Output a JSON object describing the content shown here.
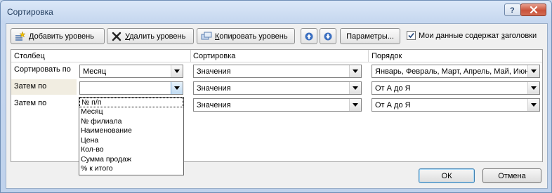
{
  "window": {
    "title": "Сортировка"
  },
  "toolbar": {
    "add_level": {
      "prefix": "",
      "underline": "Д",
      "rest": "обавить уровень"
    },
    "delete_level": {
      "prefix": "",
      "underline": "У",
      "rest": "далить уровень"
    },
    "copy_level": {
      "prefix": "",
      "underline": "К",
      "rest": "опировать уровень"
    },
    "parameters": "Параметры...",
    "headers_checkbox": {
      "label_a": "Мои данные содержат ",
      "underline": "з",
      "label_b": "аголовки",
      "checked": true
    }
  },
  "grid": {
    "headers": {
      "column": "Столбец",
      "sort": "Сортировка",
      "order": "Порядок"
    },
    "rows": [
      {
        "label": "Сортировать по",
        "column": "Месяц",
        "sort": "Значения",
        "order": "Январь, Февраль, Март, Апрель, Май, Июнь"
      },
      {
        "label": "Затем по",
        "column": "",
        "sort": "Значения",
        "order": "От А до Я"
      },
      {
        "label": "Затем по",
        "column": "",
        "sort": "Значения",
        "order": "От А до Я"
      }
    ]
  },
  "dropdown": {
    "options": [
      "№ п/п",
      "Месяц",
      "№ филиала",
      "Наименование",
      "Цена",
      "Кол-во",
      "Сумма продаж",
      "% к итого"
    ]
  },
  "footer": {
    "ok": "ОК",
    "cancel": "Отмена"
  },
  "colors": {
    "accent": "#3c7fb1",
    "close": "#c9523a"
  }
}
